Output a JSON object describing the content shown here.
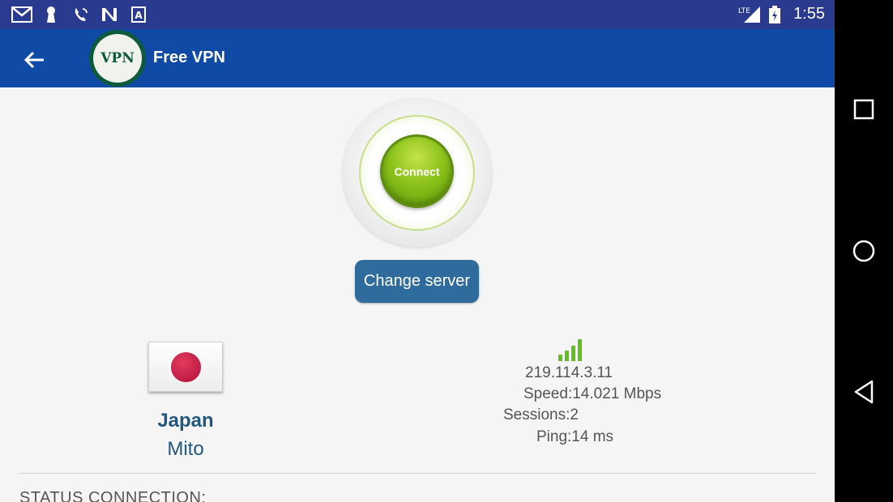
{
  "status_bar": {
    "time": "1:55",
    "network": "LTE",
    "icons": [
      "gmail-icon",
      "keyhole-icon",
      "wifi-calling-icon",
      "n-icon",
      "a-icon",
      "signal-lte-icon",
      "battery-charging-icon"
    ]
  },
  "app_bar": {
    "title": "Free VPN",
    "logo_text": "VPN",
    "back_icon": "arrow-back-icon"
  },
  "main": {
    "connect_label": "Connect",
    "change_server_label": "Change server"
  },
  "server": {
    "country": "Japan",
    "city": "Mito",
    "ip": "219.114.3.11",
    "speed": "Speed:14.021 Mbps",
    "sessions": "Sessions:2",
    "ping": "Ping:14 ms",
    "signal_bars": 4
  },
  "status": {
    "label": "STATUS CONNECTION:"
  },
  "nav_bar": {
    "icons": [
      "recents-icon",
      "home-icon",
      "back-icon"
    ]
  },
  "colors": {
    "status_bar": "#2a3a8e",
    "app_bar": "#0e4aa6",
    "connect_green": "#8cc21a",
    "button_blue": "#2f6b9c",
    "text_blue": "#22577e",
    "signal_green": "#5fc21b"
  }
}
